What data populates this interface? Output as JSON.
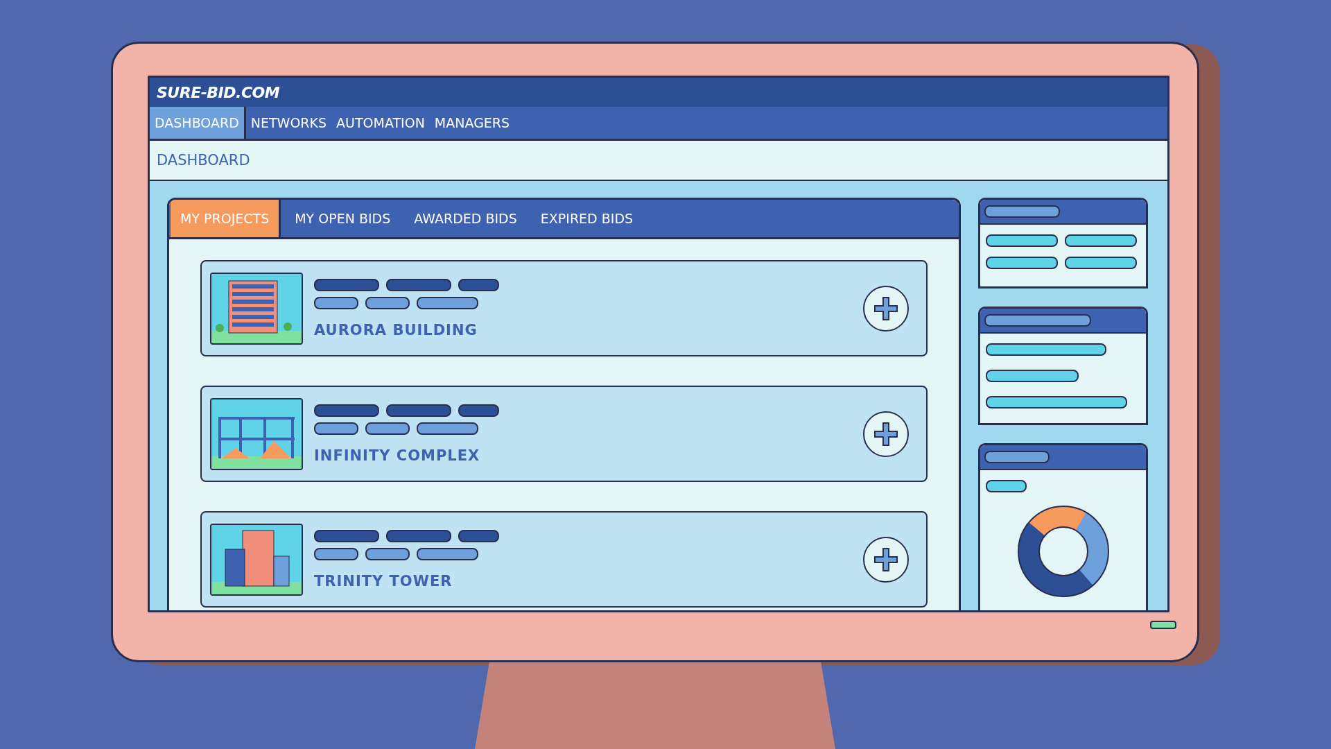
{
  "logo": "SURE-BID.COM",
  "nav": [
    {
      "label": "DASHBOARD",
      "selected": true
    },
    {
      "label": "NETWORKS",
      "selected": false
    },
    {
      "label": "AUTOMATION",
      "selected": false
    },
    {
      "label": "MANAGERS",
      "selected": false
    }
  ],
  "page_title": "DASHBOARD",
  "tabs": [
    {
      "label": "MY PROJECTS",
      "selected": true
    },
    {
      "label": "MY OPEN BIDS",
      "selected": false
    },
    {
      "label": "AWARDED BIDS",
      "selected": false
    },
    {
      "label": "EXPIRED BIDS",
      "selected": false
    }
  ],
  "projects": [
    {
      "name": "AURORA BUILDING",
      "kind": "building"
    },
    {
      "name": "INFINITY COMPLEX",
      "kind": "construction"
    },
    {
      "name": "TRINITY TOWER",
      "kind": "tower"
    }
  ]
}
